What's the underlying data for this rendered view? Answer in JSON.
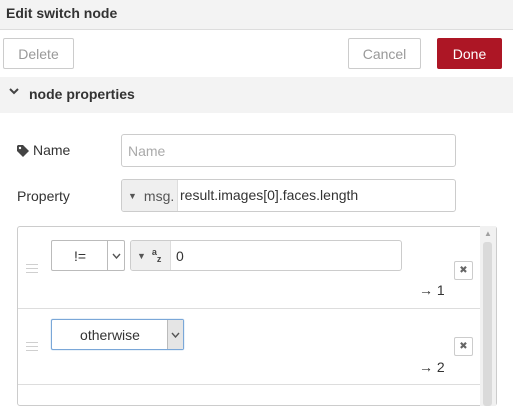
{
  "header": {
    "title": "Edit switch node"
  },
  "toolbar": {
    "delete_label": "Delete",
    "cancel_label": "Cancel",
    "done_label": "Done"
  },
  "section": {
    "label": "node properties"
  },
  "name_field": {
    "label": "Name",
    "placeholder": "Name",
    "value": ""
  },
  "property_field": {
    "label": "Property",
    "type_label": "msg.",
    "value": "result.images[0].faces.length"
  },
  "rules": [
    {
      "operator": "!=",
      "value_type_icon": "string-type-icon",
      "value": "0",
      "output": "→ 1"
    },
    {
      "operator": "otherwise",
      "output": "→ 2"
    }
  ],
  "colors": {
    "done_button": "#ad1625",
    "header_bg": "#f3f3f3",
    "focus_border": "#7aa7d8"
  },
  "icons": {
    "section_toggle": "chevron-down-icon",
    "name_label": "tag-icon",
    "remove_rule": "close-icon",
    "drag": "drag-handle-icon"
  }
}
